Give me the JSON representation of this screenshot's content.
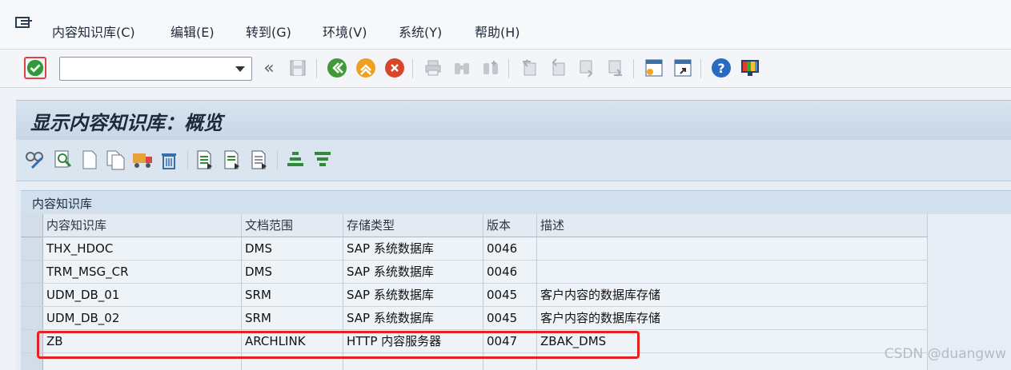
{
  "menu": {
    "items": [
      "内容知识库(C)",
      "编辑(E)",
      "转到(G)",
      "环境(V)",
      "系统(Y)",
      "帮助(H)"
    ]
  },
  "toolbar": {
    "command_field_value": "",
    "back_double_label": "«"
  },
  "title": "显示内容知识库：概览",
  "section_title": "内容知识库",
  "table": {
    "columns": [
      "内容知识库",
      "文档范围",
      "存储类型",
      "版本",
      "描述"
    ],
    "rows": [
      [
        "THX_HDOC",
        "DMS",
        "SAP 系统数据库",
        "0046",
        ""
      ],
      [
        "TRM_MSG_CR",
        "DMS",
        "SAP 系统数据库",
        "0046",
        ""
      ],
      [
        "UDM_DB_01",
        "SRM",
        "SAP 系统数据库",
        "0045",
        "客户内容的数据库存储"
      ],
      [
        "UDM_DB_02",
        "SRM",
        "SAP 系统数据库",
        "0045",
        "客户内容的数据库存储"
      ],
      [
        "ZB",
        "ARCHLINK",
        "HTTP 内容服务器",
        "0047",
        "ZBAK_DMS"
      ],
      [
        "",
        "",
        "",
        "",
        ""
      ]
    ]
  },
  "watermark": "CSDN @duangww",
  "colors": {
    "highlight": "#e32322",
    "ok_green": "#2e9a3a",
    "help_blue": "#2a6bc1"
  }
}
